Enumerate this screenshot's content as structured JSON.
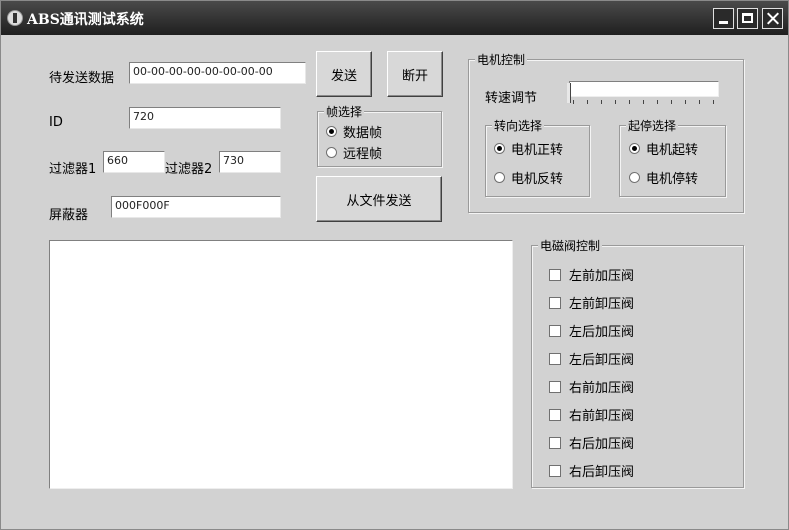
{
  "window": {
    "title": "ABS通讯测试系统",
    "icons": [
      "app-icon",
      "minimize-icon",
      "maximize-icon",
      "close-icon"
    ]
  },
  "send": {
    "data_label": "待发送数据",
    "data_value": "00-00-00-00-00-00-00-00",
    "id_label": "ID",
    "id_value": "720",
    "filter1_label": "过滤器1",
    "filter1_value": "660",
    "filter2_label": "过滤器2",
    "filter2_value": "730",
    "mask_label": "屏蔽器",
    "mask_value": "000F000F"
  },
  "buttons": {
    "send": "发送",
    "disconnect": "断开",
    "send_file": "从文件发送"
  },
  "frame_select": {
    "title": "帧选择",
    "options": [
      "数据帧",
      "远程帧"
    ],
    "selected": 0
  },
  "motor": {
    "title": "电机控制",
    "speed_label": "转速调节",
    "speed_level": 0,
    "direction": {
      "title": "转向选择",
      "options": [
        "电机正转",
        "电机反转"
      ],
      "selected": 0
    },
    "startstop": {
      "title": "起停选择",
      "options": [
        "电机起转",
        "电机停转"
      ],
      "selected": 0
    }
  },
  "valves": {
    "title": "电磁阀控制",
    "items": [
      "左前加压阀",
      "左前卸压阀",
      "左后加压阀",
      "左后卸压阀",
      "右前加压阀",
      "右前卸压阀",
      "右后加压阀",
      "右后卸压阀"
    ],
    "checked": [
      false,
      false,
      false,
      false,
      false,
      false,
      false,
      false
    ]
  },
  "colors": {
    "title_bar": "#2a2a2a",
    "window_bg": "#d2d2d2"
  }
}
